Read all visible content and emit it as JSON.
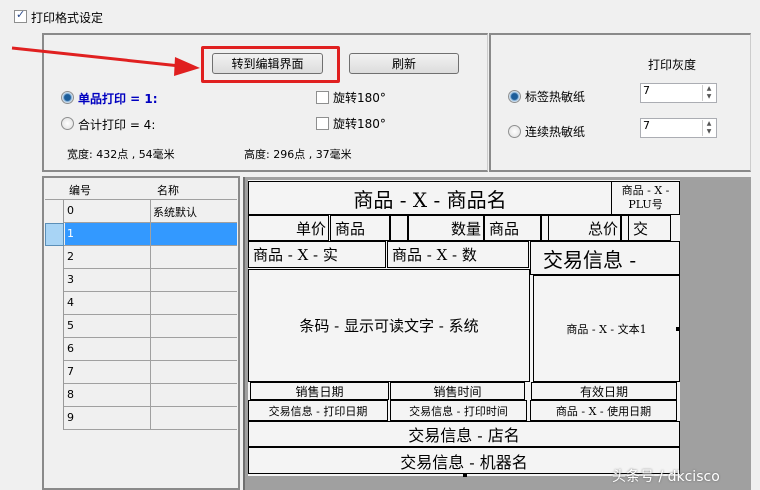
{
  "header": {
    "format_checkbox_label": "打印格式设定",
    "format_checked": true
  },
  "toolbar": {
    "edit_button": "转到编辑界面",
    "refresh_button": "刷新"
  },
  "options": {
    "single_print": "单品打印 = 1:",
    "total_print": "合计打印 = 4:",
    "rotate1": "旋转180°",
    "rotate2": "旋转180°",
    "width_text": "宽度: 432点 , 54毫米",
    "height_text": "高度: 296点 , 37毫米"
  },
  "paper": {
    "title": "打印灰度",
    "label_paper": "标签热敏纸",
    "continuous_paper": "连续热敏纸",
    "label_gray": "7",
    "continuous_gray": "7"
  },
  "grid": {
    "headers": [
      "编号",
      "名称"
    ],
    "rows": [
      {
        "id": "0",
        "name": "系统默认"
      },
      {
        "id": "1",
        "name": ""
      },
      {
        "id": "2",
        "name": ""
      },
      {
        "id": "3",
        "name": ""
      },
      {
        "id": "4",
        "name": ""
      },
      {
        "id": "5",
        "name": ""
      },
      {
        "id": "6",
        "name": ""
      },
      {
        "id": "7",
        "name": ""
      },
      {
        "id": "8",
        "name": ""
      },
      {
        "id": "9",
        "name": ""
      }
    ],
    "selected": 1
  },
  "label": {
    "title": "商品 - X - 商品名",
    "plu": "商品 - X - PLU号",
    "unit_price": "单价",
    "unit_price_val": "商品",
    "qty": "数量",
    "qty_val": "商品",
    "total": "总价",
    "total_val": "交",
    "actual": "商品 - X - 实",
    "count": "商品 - X - 数",
    "trade": "交易信息 -",
    "barcode": "条码 - 显示可读文字 - 系统",
    "text1": "商品 - X - 文本1",
    "sale_date": "销售日期",
    "sale_time": "销售时间",
    "valid_date": "有效日期",
    "print_date": "交易信息 - 打印日期",
    "print_time": "交易信息 - 打印时间",
    "use_date": "商品 - X - 使用日期",
    "store": "交易信息 - 店名",
    "machine": "交易信息 - 机器名"
  },
  "watermark": "头条号 / dkcisco",
  "colors": {
    "accent": "#3399ff",
    "highlight": "#e02020",
    "blue_text": "#0000c0"
  }
}
